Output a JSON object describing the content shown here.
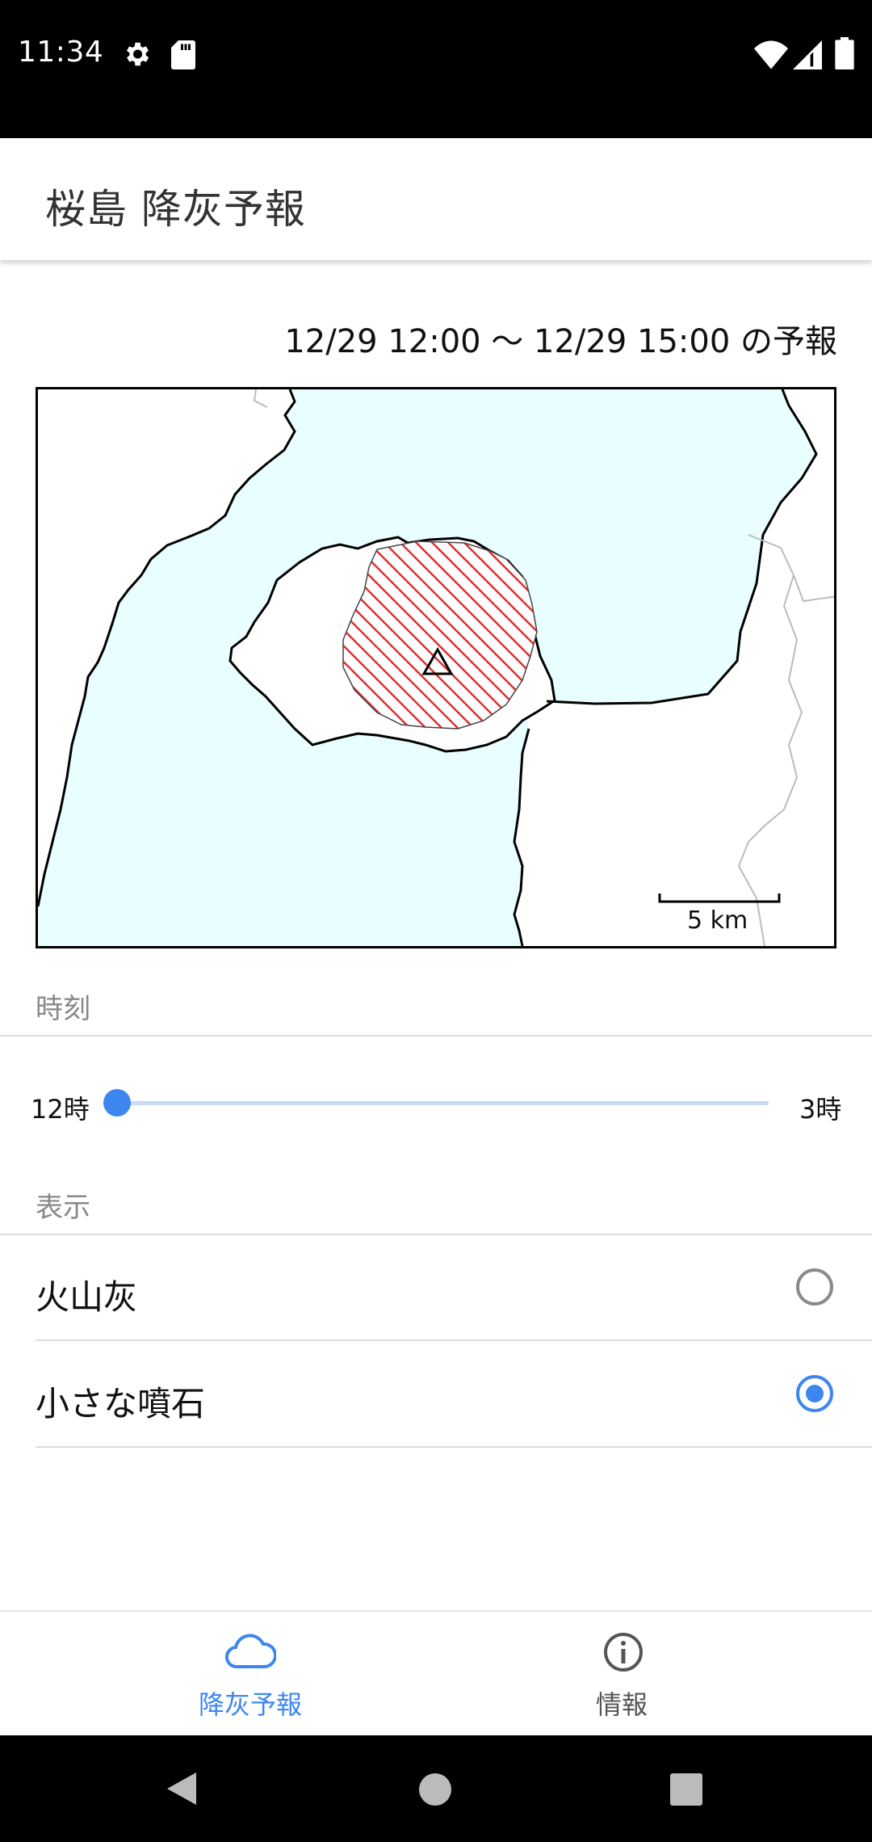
{
  "status_bar": {
    "time": "11:34",
    "icons": [
      "gear-icon",
      "sd-card-icon",
      "wifi-icon",
      "signal-icon",
      "battery-icon"
    ]
  },
  "app_bar": {
    "title": "桜島 降灰予報"
  },
  "forecast": {
    "title": "12/29 12:00 〜 12/29 15:00 の予報"
  },
  "map": {
    "scale_label": "5 km",
    "colors": {
      "sea": "#e8feff",
      "land": "#ffffff",
      "hatch": "#e03030"
    }
  },
  "time_section": {
    "label": "時刻",
    "slider_min": "12時",
    "slider_max": "3時",
    "slider_value": 0
  },
  "display_section": {
    "label": "表示",
    "options": [
      {
        "label": "火山灰",
        "selected": false
      },
      {
        "label": "小さな噴石",
        "selected": true
      }
    ]
  },
  "bottom_nav": {
    "items": [
      {
        "label": "降灰予報",
        "icon": "cloud-icon",
        "active": true
      },
      {
        "label": "情報",
        "icon": "info-icon",
        "active": false
      }
    ]
  },
  "colors": {
    "accent": "#3d86f0"
  }
}
